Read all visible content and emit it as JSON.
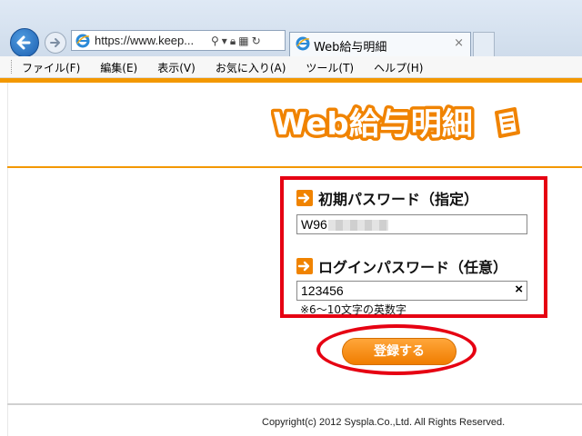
{
  "browser": {
    "url": "https://www.keep...",
    "tab_title": "Web給与明細",
    "tab_close": "×"
  },
  "menu": {
    "items": [
      "ファイル(F)",
      "編集(E)",
      "表示(V)",
      "お気に入り(A)",
      "ツール(T)",
      "ヘルプ(H)"
    ]
  },
  "logo": {
    "text": "Web給与明細",
    "color": "#f08300"
  },
  "form": {
    "initial_password_label": "初期パスワード（指定）",
    "initial_password_value": "W96",
    "login_password_label": "ログインパスワード（任意）",
    "login_password_value": "123456",
    "clear_icon": "×",
    "hint": "※6～10文字の英数字",
    "submit_label": "登録する"
  },
  "footer": {
    "copyright": "Copyright(c) 2012 Syspla.Co.,Ltd. All Rights Reserved."
  },
  "colors": {
    "accent": "#f39800",
    "highlight": "#e60012"
  }
}
